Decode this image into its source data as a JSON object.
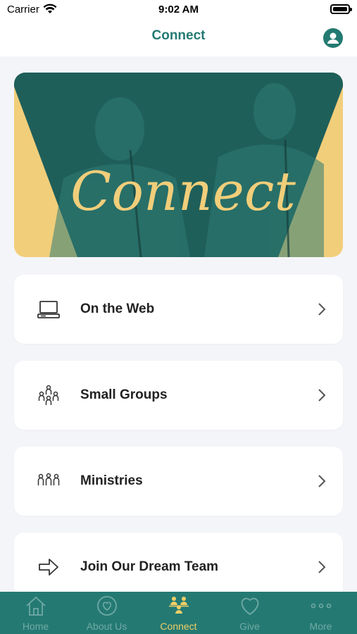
{
  "status_bar": {
    "carrier": "Carrier",
    "time": "9:02 AM"
  },
  "header": {
    "title": "Connect"
  },
  "hero": {
    "text": "Connect"
  },
  "cards": [
    {
      "label": "On the Web",
      "icon": "computer-icon"
    },
    {
      "label": "Small Groups",
      "icon": "group-icon"
    },
    {
      "label": "Ministries",
      "icon": "people-icon"
    },
    {
      "label": "Join Our Dream Team",
      "icon": "arrow-right-icon"
    }
  ],
  "tabs": [
    {
      "label": "Home",
      "icon": "home-icon",
      "active": false
    },
    {
      "label": "About Us",
      "icon": "heart-circle-icon",
      "active": false
    },
    {
      "label": "Connect",
      "icon": "connect-people-icon",
      "active": true
    },
    {
      "label": "Give",
      "icon": "heart-icon",
      "active": false
    },
    {
      "label": "More",
      "icon": "more-icon",
      "active": false
    }
  ],
  "colors": {
    "accent": "#237a72",
    "tab_active": "#f1ce66",
    "hero_yellow": "#f1ce7a",
    "hero_teal": "#1f5f5a"
  }
}
